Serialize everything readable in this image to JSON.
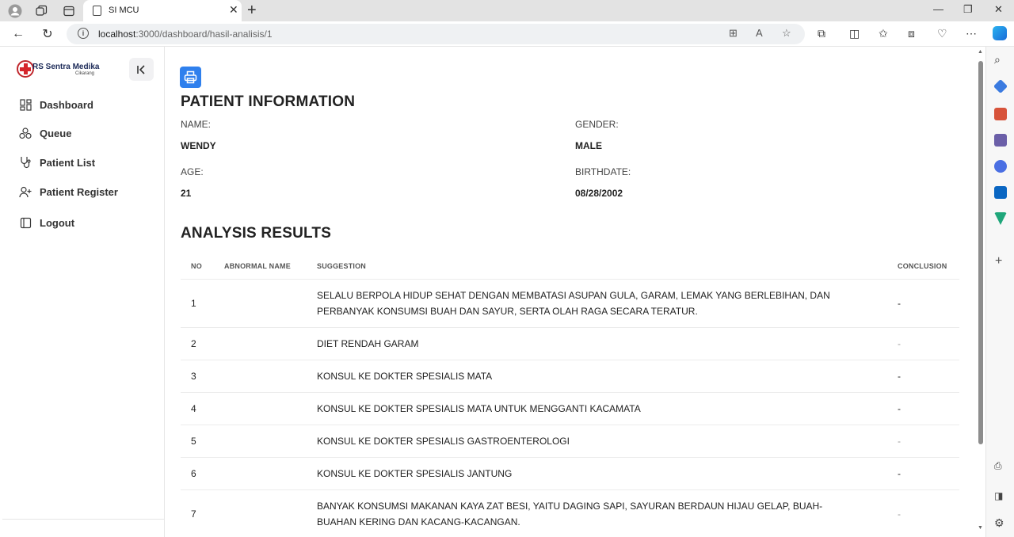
{
  "browser": {
    "tab_title": "SI MCU",
    "url_host": "localhost",
    "url_rest": ":3000/dashboard/hasil-analisis/1"
  },
  "sidebar": {
    "logo_text": "RS Sentra Medika",
    "logo_sub": "Cikarang",
    "items": [
      {
        "label": "Dashboard",
        "icon": "dashboard-icon"
      },
      {
        "label": "Queue",
        "icon": "queue-icon"
      },
      {
        "label": "Patient List",
        "icon": "stethoscope-icon"
      },
      {
        "label": "Patient Register",
        "icon": "user-plus-icon"
      },
      {
        "label": "Logout",
        "icon": "logout-icon"
      }
    ]
  },
  "patient": {
    "heading": "PATIENT INFORMATION",
    "name_label": "NAME:",
    "name": "WENDY",
    "gender_label": "GENDER:",
    "gender": "MALE",
    "age_label": "AGE:",
    "age": "21",
    "birthdate_label": "BIRTHDATE:",
    "birthdate": "08/28/2002"
  },
  "results": {
    "heading": "ANALYSIS RESULTS",
    "columns": {
      "no": "NO",
      "abnormal": "ABNORMAL NAME",
      "suggestion": "SUGGESTION",
      "conclusion": "CONCLUSION"
    },
    "rows": [
      {
        "no": "1",
        "abnormal": "",
        "suggestion": "SELALU BERPOLA HIDUP SEHAT DENGAN MEMBATASI ASUPAN GULA, GARAM, LEMAK YANG BERLEBIHAN, DAN PERBANYAK KONSUMSI BUAH DAN SAYUR, SERTA OLAH RAGA SECARA TERATUR.",
        "conclusion": "-"
      },
      {
        "no": "2",
        "abnormal": "",
        "suggestion": "DIET RENDAH GARAM",
        "conclusion": "-"
      },
      {
        "no": "3",
        "abnormal": "",
        "suggestion": "KONSUL KE DOKTER SPESIALIS MATA",
        "conclusion": "-"
      },
      {
        "no": "4",
        "abnormal": "",
        "suggestion": "KONSUL KE DOKTER SPESIALIS MATA UNTUK MENGGANTI KACAMATA",
        "conclusion": "-"
      },
      {
        "no": "5",
        "abnormal": "",
        "suggestion": "KONSUL KE DOKTER SPESIALIS GASTROENTEROLOGI",
        "conclusion": "-"
      },
      {
        "no": "6",
        "abnormal": "",
        "suggestion": "KONSUL KE DOKTER SPESIALIS JANTUNG",
        "conclusion": "-"
      },
      {
        "no": "7",
        "abnormal": "",
        "suggestion": "BANYAK KONSUMSI MAKANAN KAYA ZAT BESI, YAITU DAGING SAPI, SAYURAN BERDAUN HIJAU GELAP, BUAH-BUAHAN KERING DAN KACANG-KACANGAN.",
        "conclusion": "-"
      }
    ]
  },
  "colors": {
    "accent": "#2f80ed",
    "logo_red": "#d6262c"
  }
}
